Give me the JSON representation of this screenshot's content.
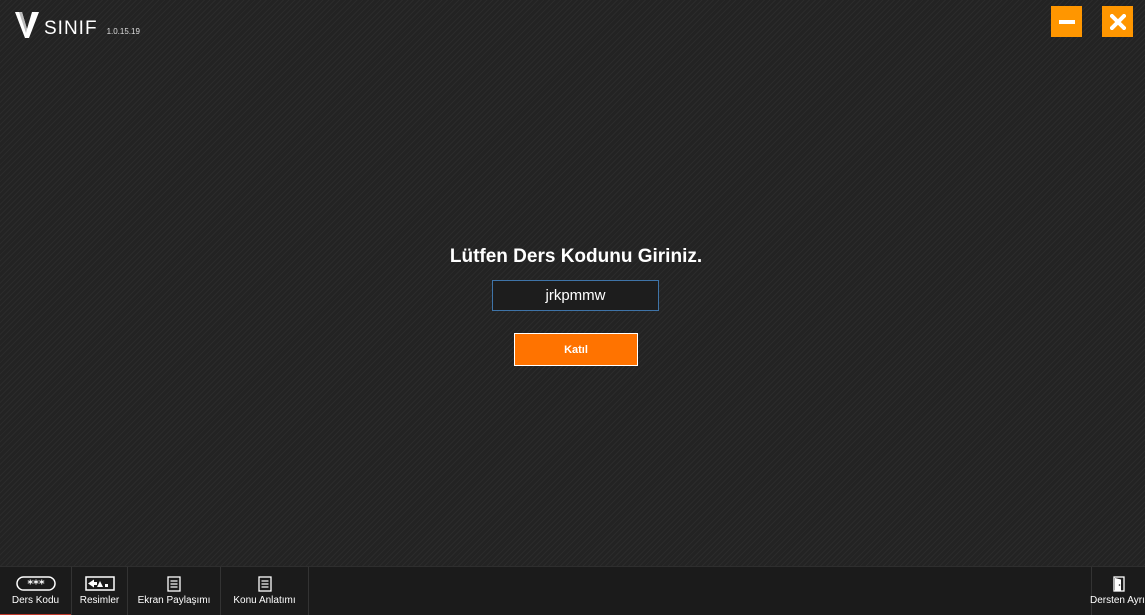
{
  "app": {
    "logo_text": "SINIF",
    "version": "1.0.15.19"
  },
  "window_controls": {
    "minimize_icon": "minus-icon",
    "close_icon": "close-icon"
  },
  "login": {
    "prompt": "Lütfen Ders Kodunu Giriniz.",
    "code_value": "jrkpmmw",
    "join_label": "Katıl"
  },
  "toolbar": {
    "items": [
      {
        "label": "Ders Kodu",
        "icon": "password-icon"
      },
      {
        "label": "Resimler",
        "icon": "images-icon"
      },
      {
        "label": "Ekran Paylaşımı",
        "icon": "document-icon"
      },
      {
        "label": "Konu Anlatımı",
        "icon": "document-icon"
      }
    ],
    "leave": {
      "label": "Dersten Ayrıl",
      "icon": "door-icon"
    }
  },
  "colors": {
    "accent": "#ff9600",
    "join_button": "#ff7300",
    "orange_tab": "#ff9a2e"
  }
}
